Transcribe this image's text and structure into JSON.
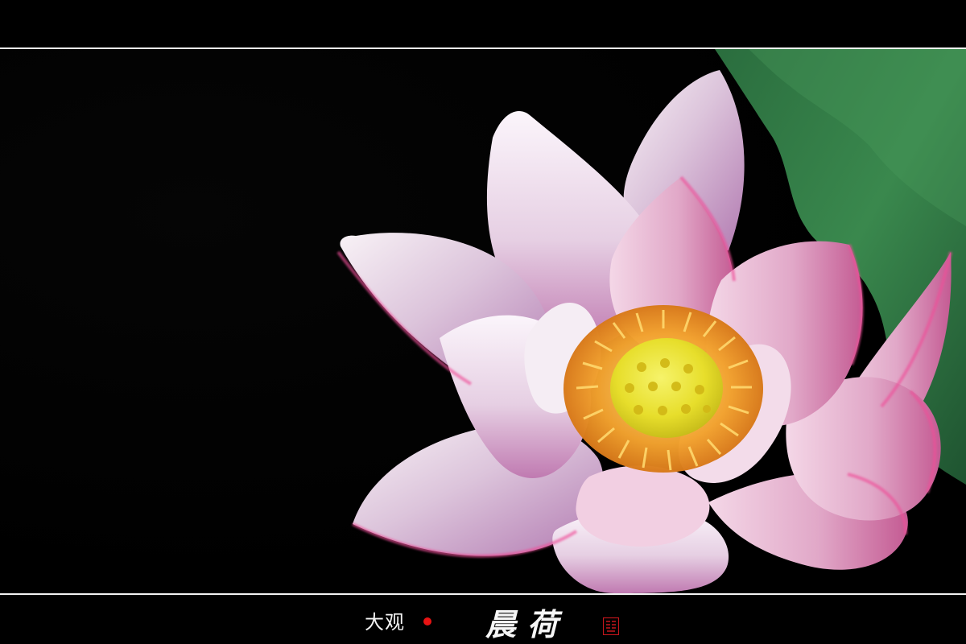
{
  "caption": {
    "small_text": "大观",
    "title": "晨荷",
    "seal_text": "大观之印",
    "dot_color": "#e81313"
  },
  "photo": {
    "subject": "pink-lotus-flower",
    "leaf_color": "#2f7a42",
    "background_color": "#000000"
  }
}
